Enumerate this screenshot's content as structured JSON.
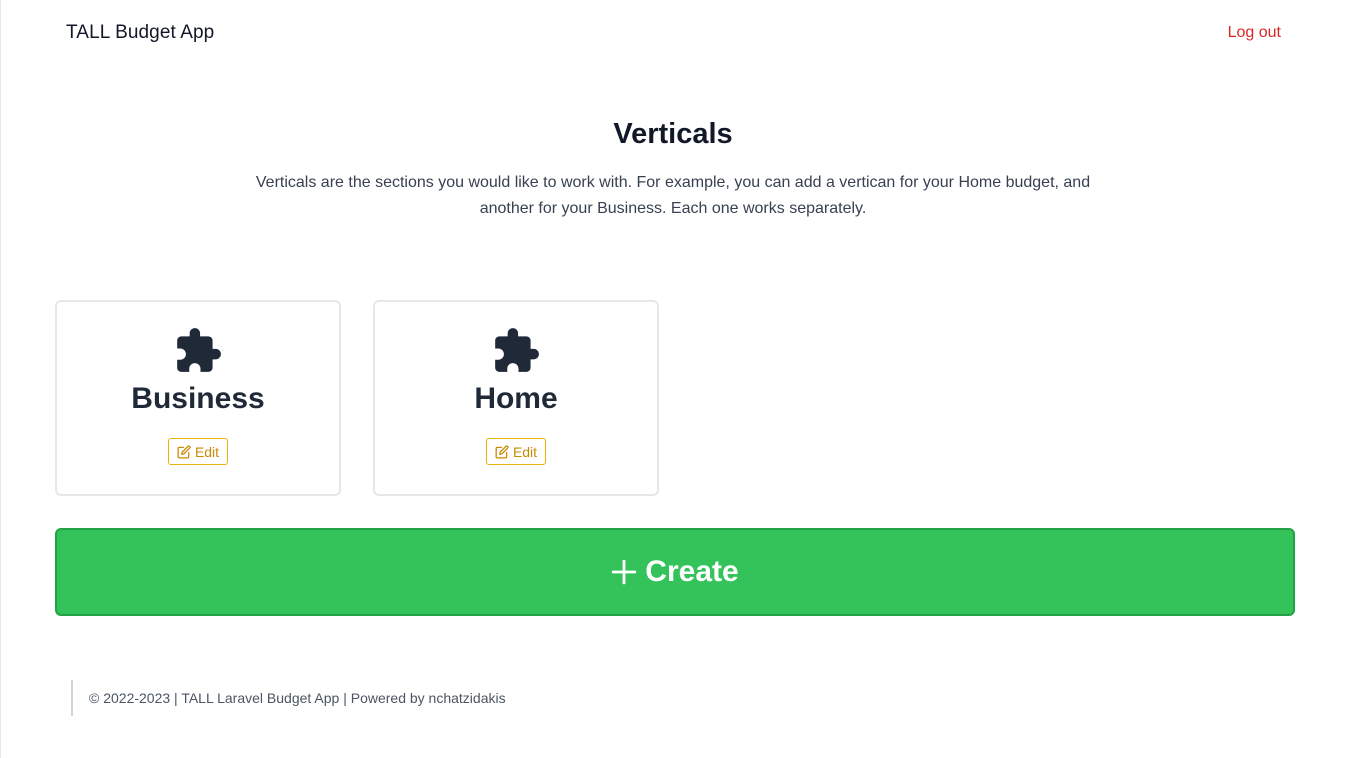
{
  "header": {
    "app_title": "TALL Budget App",
    "logout_label": "Log out"
  },
  "hero": {
    "title": "Verticals",
    "description": "Verticals are the sections you would like to work with. For example, you can add a vertican for your Home budget, and another for your Business. Each one works separately."
  },
  "verticals": [
    {
      "name": "Business",
      "icon": "puzzle-icon",
      "edit_label": "Edit"
    },
    {
      "name": "Home",
      "icon": "puzzle-icon",
      "edit_label": "Edit"
    }
  ],
  "create_button": {
    "label": "Create",
    "icon": "plus-icon",
    "color": "#34c35a"
  },
  "footer": {
    "text": "© 2022-2023 | TALL Laravel Budget App | Powered by nchatzidakis"
  },
  "colors": {
    "logout": "#dc2626",
    "edit": "#ca8a04",
    "create_bg": "#34c35a"
  }
}
